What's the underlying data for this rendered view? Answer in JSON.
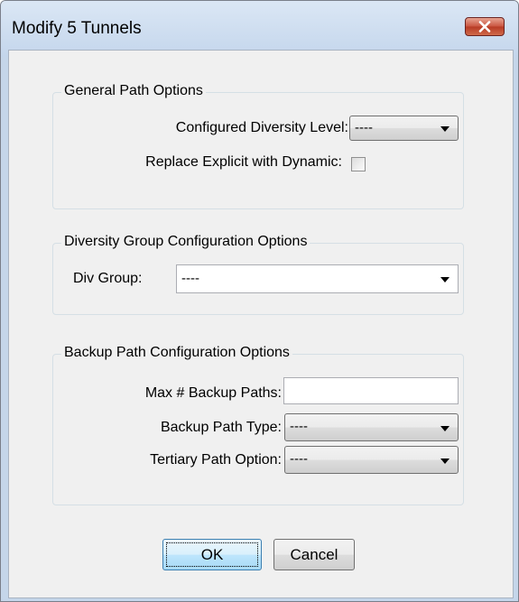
{
  "window": {
    "title": "Modify 5 Tunnels"
  },
  "general_path_options": {
    "legend": "General Path Options",
    "diversity_level_label": "Configured Diversity Level:",
    "diversity_level_value": "----",
    "replace_explicit_label": "Replace Explicit with Dynamic:",
    "replace_explicit_checked": false
  },
  "diversity_group_options": {
    "legend": "Diversity Group Configuration Options",
    "div_group_label": "Div Group:",
    "div_group_value": "----"
  },
  "backup_path_options": {
    "legend": "Backup Path Configuration Options",
    "max_backup_label": "Max # Backup Paths:",
    "max_backup_value": "",
    "backup_type_label": "Backup Path Type:",
    "backup_type_value": "----",
    "tertiary_label": "Tertiary Path Option:",
    "tertiary_value": "----"
  },
  "buttons": {
    "ok": "OK",
    "cancel": "Cancel"
  },
  "icons": {
    "close": "close-icon",
    "dropdown": "chevron-down-icon"
  },
  "colors": {
    "close_button": "#c9533e",
    "dialog_background": "#f0f0f0",
    "frame": "#c5d6ea"
  }
}
